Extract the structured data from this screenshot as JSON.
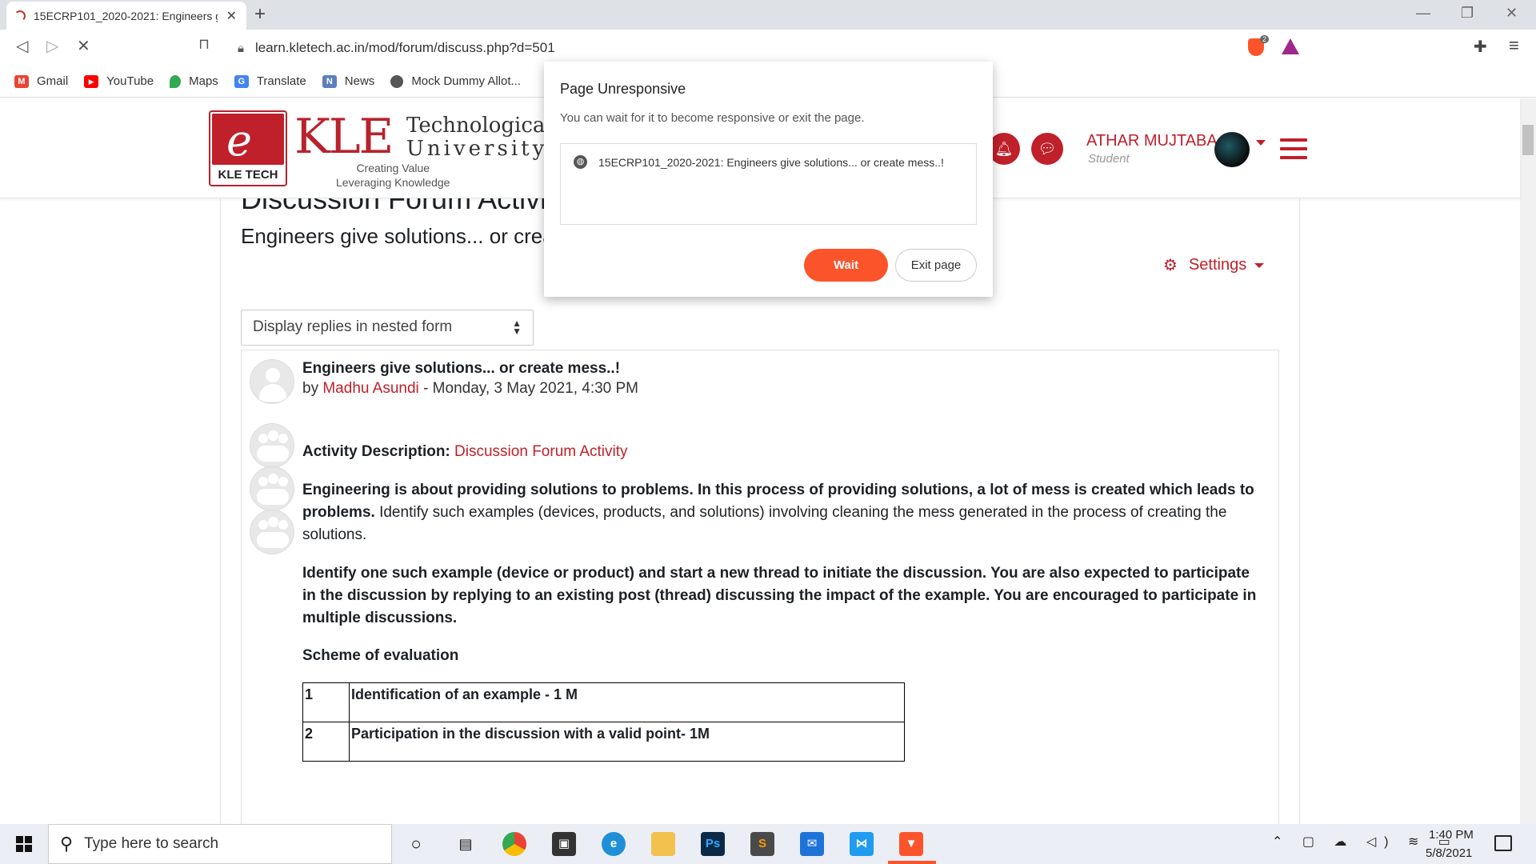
{
  "browser": {
    "tab_title": "15ECRP101_2020-2021: Engineers give solutions... or create mess..!",
    "url": "learn.kletech.ac.in/mod/forum/discuss.php?d=501",
    "shields_count": "2",
    "bookmarks": [
      {
        "label": "Gmail",
        "icon": "gmail-icon",
        "color": "#ea4335",
        "glyph": "M"
      },
      {
        "label": "YouTube",
        "icon": "youtube-icon",
        "color": "#ff0000",
        "glyph": "▶"
      },
      {
        "label": "Maps",
        "icon": "maps-icon",
        "color": "#34a853",
        "glyph": "●"
      },
      {
        "label": "Translate",
        "icon": "translate-icon",
        "color": "#4285f4",
        "glyph": "G"
      },
      {
        "label": "News",
        "icon": "news-icon",
        "color": "#5b7fbd",
        "glyph": "N"
      },
      {
        "label": "Mock Dummy Allot...",
        "icon": "globe-icon",
        "color": "#555555",
        "glyph": "◐"
      }
    ]
  },
  "site": {
    "logo_letter": "e",
    "logo_name": "KLE TECH",
    "brand_kle": "KLE",
    "brand_line1": "Technological",
    "brand_line2": "University",
    "tagline1": "Creating Value",
    "tagline2": "Leveraging Knowledge",
    "user_name": "ATHAR MUJTABA",
    "user_role": "Student"
  },
  "content": {
    "heading": "Discussion Forum Activity",
    "forum_name": "Engineers give solutions... or create mess..!",
    "settings_label": "Settings",
    "display_mode": "Display replies in nested form",
    "post": {
      "subject": "Engineers give solutions... or create mess..!",
      "by": "by",
      "author": "Madhu Asundi",
      "date": "- Monday, 3 May 2021, 4:30 PM",
      "activity_label": "Activity Description:",
      "activity_link": "Discussion Forum Activity",
      "para1_bold": "Engineering is about providing solutions to problems. In this process of providing solutions, a lot of mess is created which leads to problems.",
      "para1_rest": " Identify such examples (devices, products, and solutions) involving cleaning the mess generated in the process of creating the solutions.",
      "para2": "Identify one such example (device or product) and start a new thread to initiate the discussion. You are also expected to participate in the discussion by replying to an existing post (thread) discussing the impact of the example. You are encouraged to participate in multiple discussions.",
      "scheme_title": "Scheme of evaluation",
      "table": [
        {
          "n": "1",
          "text": "Identification of an example - 1 M"
        },
        {
          "n": "2",
          "text": "Participation in the discussion with a valid point- 1M"
        }
      ]
    }
  },
  "dialog": {
    "title": "Page Unresponsive",
    "message": "You can wait for it to become responsive or exit the page.",
    "page_item": "15ECRP101_2020-2021: Engineers give solutions... or create mess..!",
    "wait_label": "Wait",
    "exit_label": "Exit page"
  },
  "taskbar": {
    "search_placeholder": "Type here to search",
    "time": "1:40 PM",
    "date": "5/8/2021"
  },
  "colors": {
    "brand_red": "#c0202a",
    "brave_orange": "#fb542b"
  }
}
